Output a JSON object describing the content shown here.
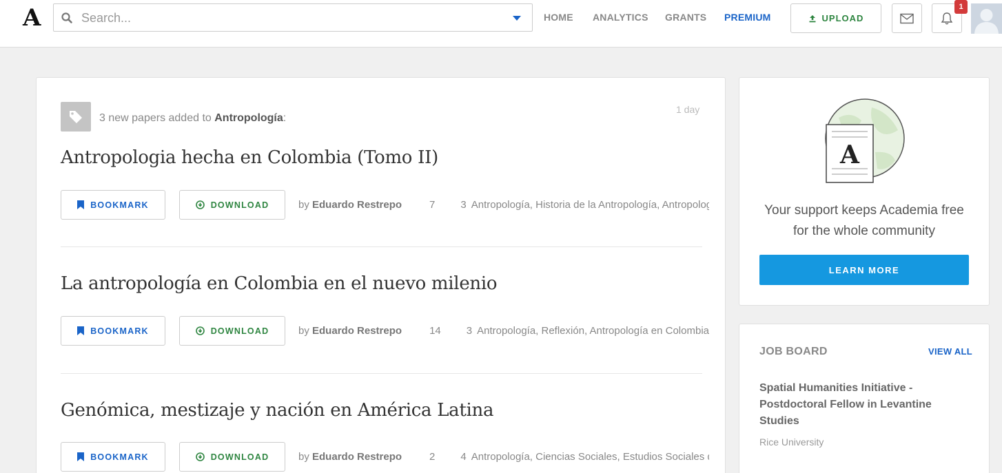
{
  "header": {
    "logo": "A",
    "search_placeholder": "Search...",
    "nav": [
      {
        "label": "HOME"
      },
      {
        "label": "ANALYTICS"
      },
      {
        "label": "GRANTS"
      },
      {
        "label": "PREMIUM"
      }
    ],
    "upload_label": "UPLOAD",
    "notification_count": "1"
  },
  "feed": {
    "notice_prefix": "3 new papers added to ",
    "notice_topic": "Antropología",
    "notice_suffix": ":",
    "time_ago": "1 day",
    "bookmark_label": "BOOKMARK",
    "download_label": "DOWNLOAD",
    "papers": [
      {
        "title": "Antropologia hecha en Colombia (Tomo II)",
        "by": "by ",
        "author": "Eduardo Restrepo",
        "views": "7",
        "tag_count": "3",
        "tags": "Antropología, Historia de la Antropología, Antropología en Colombia"
      },
      {
        "title": "La antropología en Colombia en el nuevo milenio",
        "by": "by ",
        "author": "Eduardo Restrepo",
        "views": "14",
        "tag_count": "3",
        "tags": "Antropología, Reflexión, Antropología en Colombia"
      },
      {
        "title": "Genómica, mestizaje y nación en América Latina",
        "by": "by ",
        "author": "Eduardo Restrepo",
        "views": "2",
        "tag_count": "4",
        "tags": "Antropología, Ciencias Sociales, Estudios Sociales de la Ciencia"
      }
    ]
  },
  "support": {
    "logo_letter": "A",
    "text_line1": "Your support keeps Academia free",
    "text_line2": "for the whole community",
    "button": "LEARN MORE"
  },
  "jobs": {
    "heading": "JOB BOARD",
    "view_all": "VIEW ALL",
    "title": "Spatial Humanities Initiative - Postdoctoral Fellow in Levantine Studies",
    "org": "Rice University"
  },
  "colors": {
    "accent_blue": "#1a64c8",
    "download_green": "#2e8540",
    "learn_more_blue": "#1598e0",
    "badge_red": "#d33b3b"
  }
}
